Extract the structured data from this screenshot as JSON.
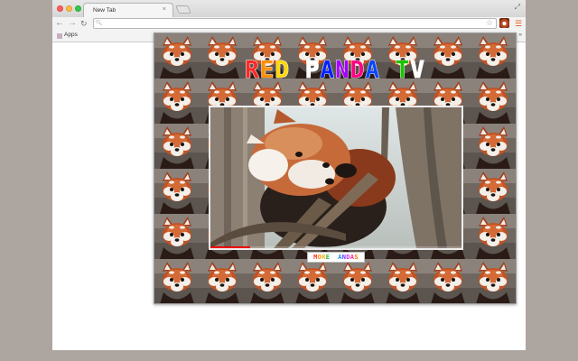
{
  "browser": {
    "tab_title": "New Tab",
    "tab_close": "×",
    "address_value": "",
    "apps_label": "Apps",
    "bookmarks_overflow": "»"
  },
  "popup": {
    "title": "RED PANDA TV",
    "title_colors": [
      "#ff2727",
      "#ff8f00",
      "#ffd800",
      "#ffffff",
      "#0022ff",
      "#a300ff",
      "#ff0080",
      "#0a46ff",
      "#18c400",
      "#ffffff",
      "#00a6ff",
      "#00d23c"
    ],
    "more_button_label": "MORE PANDAS",
    "more_button_colors": [
      "#ff2b2b",
      "#ff8a00",
      "#e6c400",
      "#27b84a",
      "#ffffff",
      "#1c8bff",
      "#6a3dff",
      "#cc28ff",
      "#ff2b8b",
      "#ff6a00",
      "#23b9c8"
    ],
    "video_progress_fraction": 0.16
  },
  "colors": {
    "desktop_bg": "#ada59f",
    "panda_fur": "#b9481f",
    "video_progress": "#ee0000"
  }
}
